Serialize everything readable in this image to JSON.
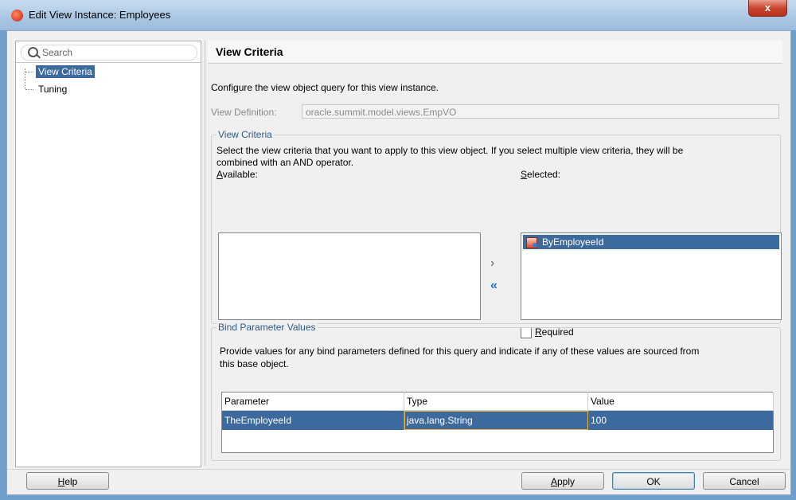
{
  "window": {
    "title": "Edit View Instance: Employees",
    "close": "x"
  },
  "search": {
    "placeholder": "Search"
  },
  "nav": {
    "items": [
      {
        "label": "View Criteria"
      },
      {
        "label": "Tuning"
      }
    ]
  },
  "page": {
    "title": "View Criteria",
    "description": "Configure the view object query for this view instance.",
    "view_definition_label": "View Definition:",
    "view_definition_value": "oracle.summit.model.views.EmpVO"
  },
  "criteria": {
    "group_title": "View Criteria",
    "text1": "Select the view criteria that you want to apply to this view object. If you select multiple view criteria, they will be",
    "text2": "combined with an AND operator.",
    "available_label": "Available:",
    "selected_label": "Selected:",
    "selected_items": [
      "ByEmployeeId"
    ],
    "required_label": "Required",
    "move_right": "›",
    "move_left": "«"
  },
  "bind": {
    "group_title": "Bind Parameter Values",
    "text1": "Provide values for any bind parameters defined for this query and indicate if any of these values are sourced from",
    "text2": "this base object.",
    "columns": [
      "Parameter",
      "Type",
      "Value"
    ],
    "rows": [
      [
        "TheEmployeeId",
        "java.lang.String",
        "100"
      ]
    ]
  },
  "buttons": {
    "help": "Help",
    "apply": "Apply",
    "ok": "OK",
    "cancel": "Cancel"
  },
  "colors": {
    "selection": "#3d6a9c",
    "title_bar": "#a9c6e3",
    "group_title": "#2e5a8a"
  }
}
